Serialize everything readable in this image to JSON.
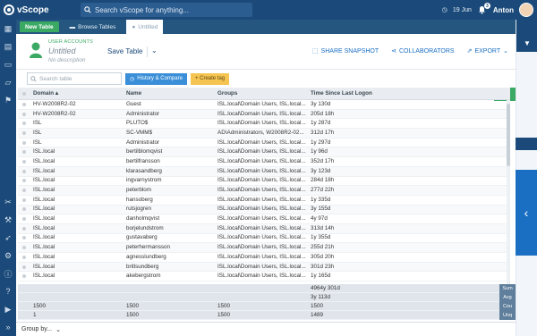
{
  "app": {
    "name": "vScope"
  },
  "search": {
    "placeholder": "Search vScope for anything..."
  },
  "topbar": {
    "date": "19 Jun",
    "notifications": "3",
    "user": "Anton"
  },
  "tabs": {
    "new_table": "New Table",
    "browse": "Browse Tables",
    "current": "Untitled"
  },
  "header": {
    "section_label": "USER ACCOUNTS",
    "title": "Untitled",
    "description": "No description",
    "save": "Save Table",
    "actions": [
      "SHARE SNAPSHOT",
      "COLLABORATORS",
      "EXPORT"
    ]
  },
  "toolbar": {
    "filter_placeholder": "Search table",
    "history": "History & Compare",
    "create_tag": "+ Create tag"
  },
  "table": {
    "columns": [
      "Domain",
      "Name",
      "Groups",
      "Time Since Last Logon"
    ],
    "rows": [
      [
        "HV-W2008R2-02",
        "Guest",
        "ISL.local\\Domain Users, ISL.local...",
        "3y 130d"
      ],
      [
        "HV-W2008R2-02",
        "Administrator",
        "ISL.local\\Domain Users, ISL.local...",
        "205d 18h"
      ],
      [
        "ISL",
        "PLUTO$",
        "ISL.local\\Domain Users, ISL.local...",
        "1y 287d"
      ],
      [
        "ISL",
        "SC-VMM$",
        "AD\\Administrators, W2008R2-02...",
        "312d 17h"
      ],
      [
        "ISL",
        "Administrator",
        "ISL.local\\Domain Users, ISL.local...",
        "1y 297d"
      ],
      [
        "ISL.local",
        "bertilblomqvist",
        "ISL.local\\Domain Users, ISL.local...",
        "1y 96d"
      ],
      [
        "ISL.local",
        "bertilfransson",
        "ISL.local\\Domain Users, ISL.local...",
        "352d 17h"
      ],
      [
        "ISL.local",
        "klarasandberg",
        "ISL.local\\Domain Users, ISL.local...",
        "3y 123d"
      ],
      [
        "ISL.local",
        "ingvarnystrom",
        "ISL.local\\Domain Users, ISL.local...",
        "284d 18h"
      ],
      [
        "ISL.local",
        "peterblom",
        "ISL.local\\Domain Users, ISL.local...",
        "277d 22h"
      ],
      [
        "ISL.local",
        "hansoberg",
        "ISL.local\\Domain Users, ISL.local...",
        "1y 335d"
      ],
      [
        "ISL.local",
        "rutsjogren",
        "ISL.local\\Domain Users, ISL.local...",
        "3y 155d"
      ],
      [
        "ISL.local",
        "danholmqvist",
        "ISL.local\\Domain Users, ISL.local...",
        "4y 97d"
      ],
      [
        "ISL.local",
        "borjelundstrom",
        "ISL.local\\Domain Users, ISL.local...",
        "313d 14h"
      ],
      [
        "ISL.local",
        "gustavaberg",
        "ISL.local\\Domain Users, ISL.local...",
        "1y 355d"
      ],
      [
        "ISL.local",
        "peterhermansson",
        "ISL.local\\Domain Users, ISL.local...",
        "255d 21h"
      ],
      [
        "ISL.local",
        "agnesslundberg",
        "ISL.local\\Domain Users, ISL.local...",
        "305d 20h"
      ],
      [
        "ISL.local",
        "britlsundberg",
        "ISL.local\\Domain Users, ISL.local...",
        "301d 23h"
      ],
      [
        "ISL.local",
        "akebergstrom",
        "ISL.local\\Domain Users, ISL.local...",
        "1y 165d"
      ]
    ]
  },
  "summary": [
    {
      "c1": "",
      "c2": "",
      "c3": "",
      "c4": "4964y 301d",
      "label": "Sum"
    },
    {
      "c1": "",
      "c2": "",
      "c3": "",
      "c4": "3y 113d",
      "label": "Avg"
    },
    {
      "c1": "1500",
      "c2": "1500",
      "c3": "1500",
      "c4": "1500",
      "label": "Cou"
    },
    {
      "c1": "1",
      "c2": "1500",
      "c3": "1500",
      "c4": "1489",
      "label": "Unq"
    }
  ],
  "bottombar": {
    "group_by": "Group by..."
  },
  "colors": {
    "primary": "#1b4a7a",
    "accent": "#3aa964",
    "link": "#1b6fc2"
  }
}
